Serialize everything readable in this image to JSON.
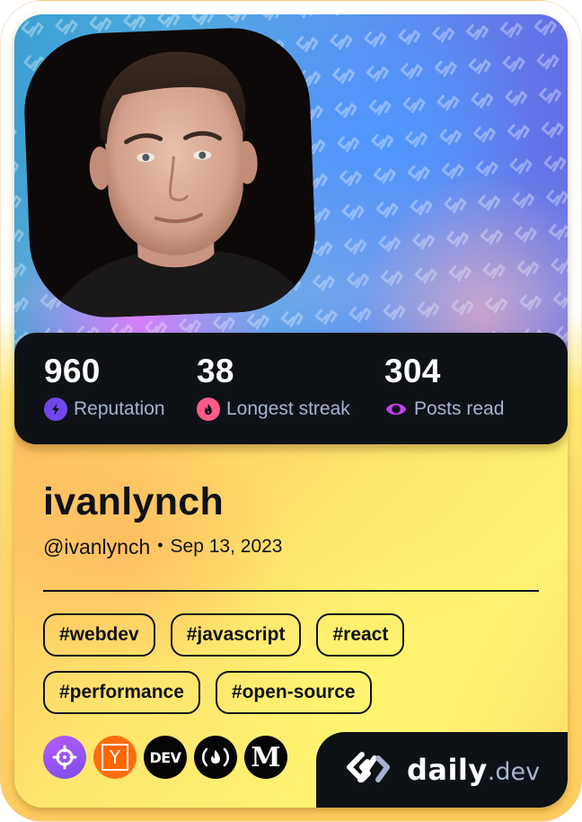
{
  "profile": {
    "photo_alt": "Profile photo of ivanlynch",
    "name": "ivanlynch",
    "handle": "@ivanlynch",
    "separator": "•",
    "joined": "Sep 13, 2023"
  },
  "stats": [
    {
      "value": "960",
      "label": "Reputation",
      "icon": "lightning-icon",
      "color": "#7147ed"
    },
    {
      "value": "38",
      "label": "Longest streak",
      "icon": "flame-icon",
      "color": "#ff5b8a"
    },
    {
      "value": "304",
      "label": "Posts read",
      "icon": "eye-icon",
      "color": "#c340f0"
    }
  ],
  "tags": [
    "#webdev",
    "#javascript",
    "#react",
    "#performance",
    "#open-source"
  ],
  "sources": [
    {
      "name": "crosshair-source",
      "icon": "crosshair-icon"
    },
    {
      "name": "y-combinator",
      "icon": "y-combinator-icon",
      "glyph": "Y"
    },
    {
      "name": "dev-to",
      "icon": "dev-icon",
      "glyph": "DEV"
    },
    {
      "name": "freecodecamp",
      "icon": "freecodecamp-icon",
      "glyph": "(🔥)"
    },
    {
      "name": "medium",
      "icon": "medium-icon",
      "glyph": "M"
    }
  ],
  "brand": {
    "name": "daily",
    "tld": ".dev"
  },
  "colors": {
    "dark": "#0e1217",
    "muted": "#a8b3cf",
    "card_yellow": "#ffe56e",
    "card_orange": "#ffbf60"
  }
}
